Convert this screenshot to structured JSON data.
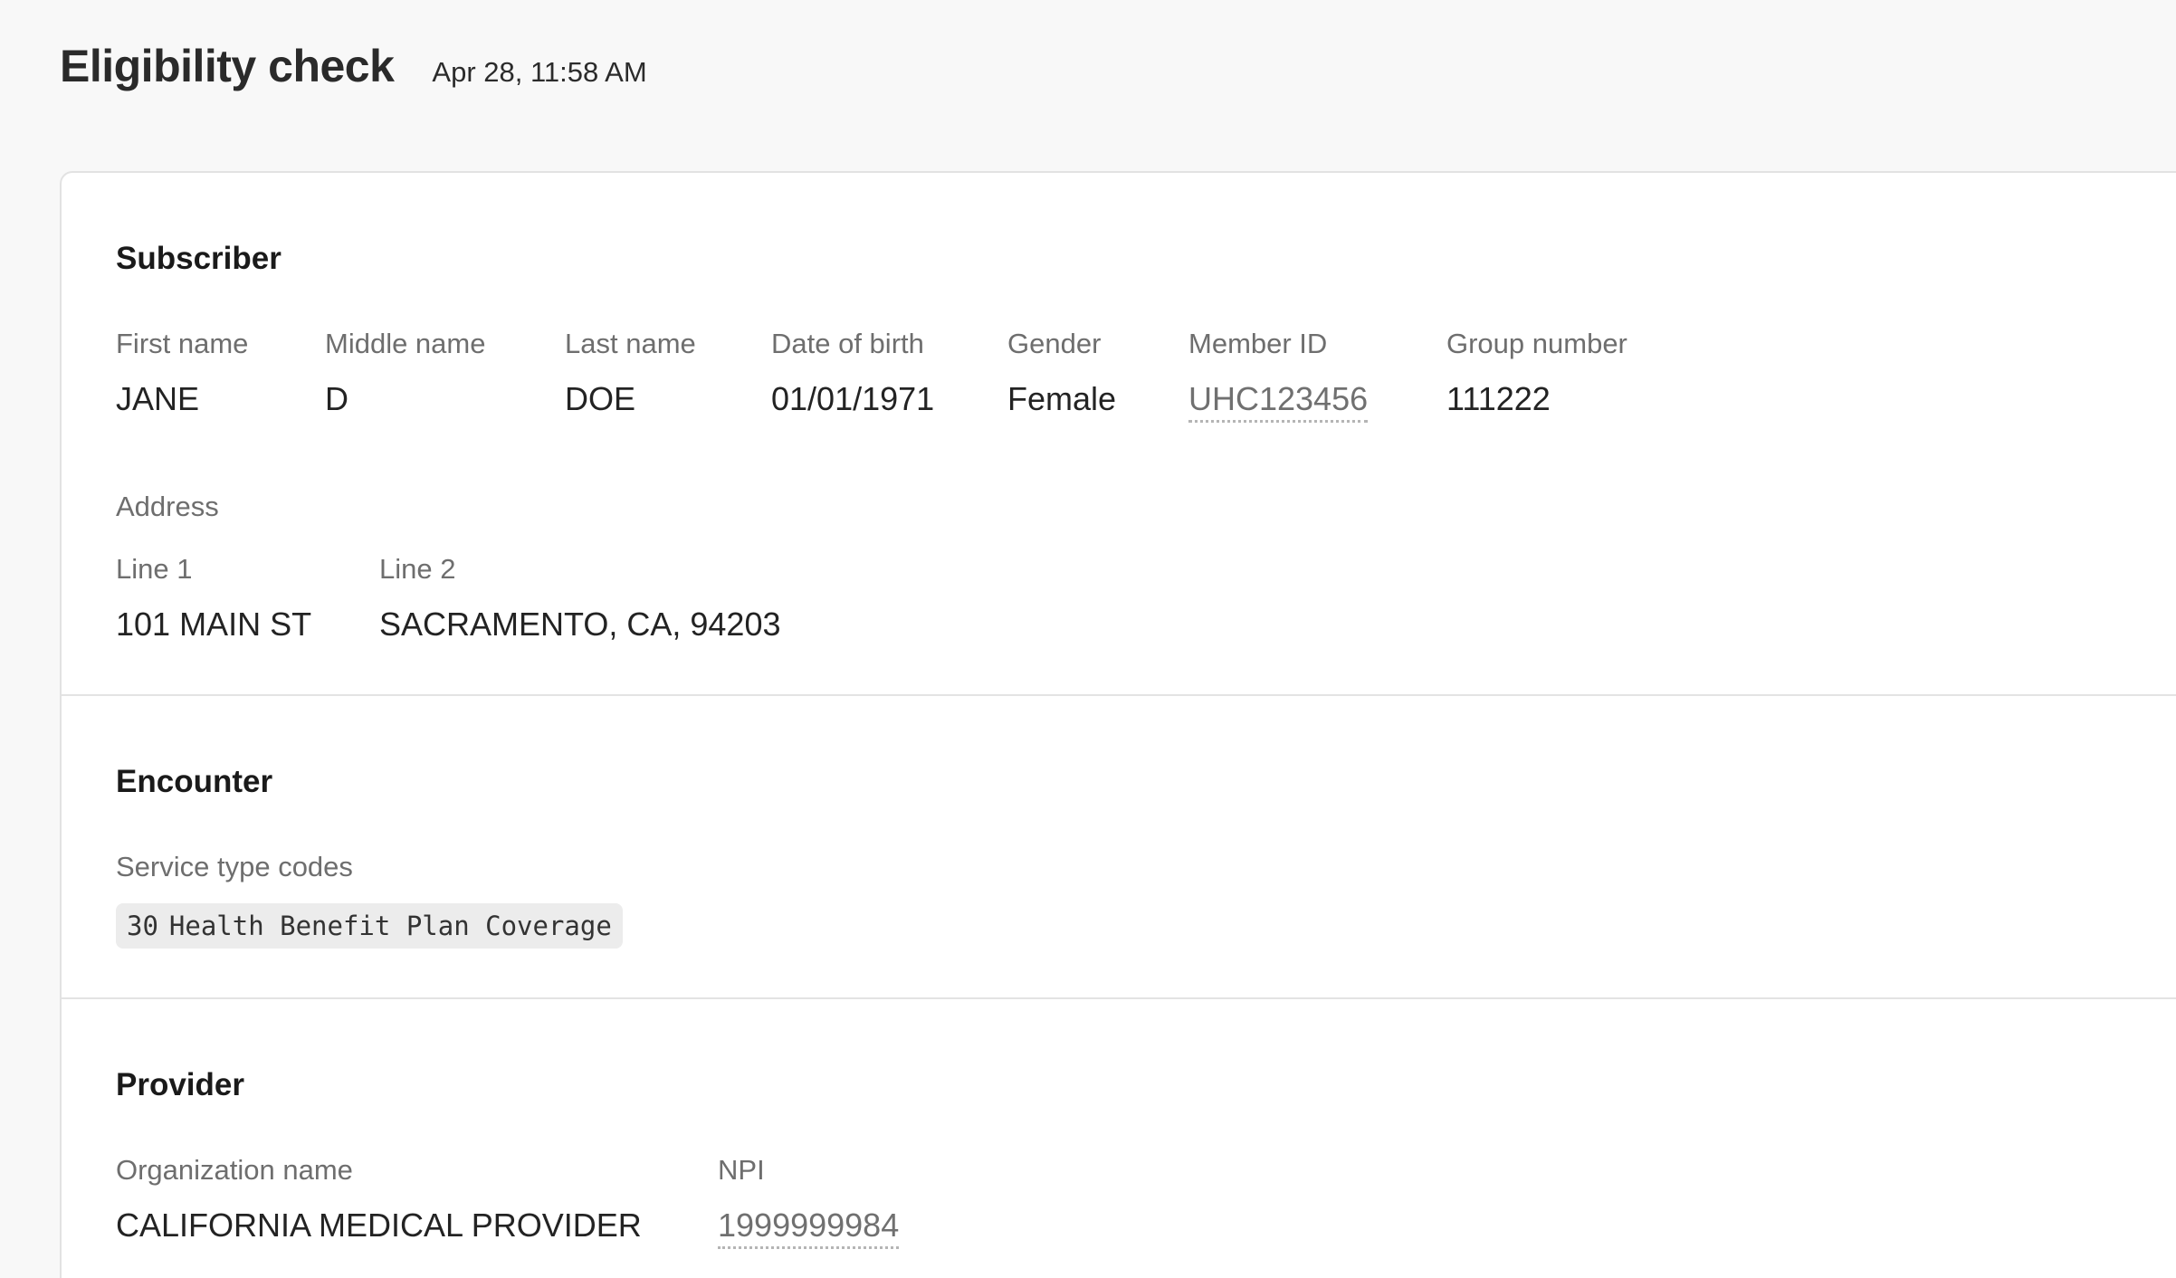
{
  "header": {
    "title": "Eligibility check",
    "timestamp": "Apr 28, 11:58 AM"
  },
  "subscriber": {
    "title": "Subscriber",
    "fields": {
      "first_name": {
        "label": "First name",
        "value": "JANE"
      },
      "middle_name": {
        "label": "Middle name",
        "value": "D"
      },
      "last_name": {
        "label": "Last name",
        "value": "DOE"
      },
      "dob": {
        "label": "Date of birth",
        "value": "01/01/1971"
      },
      "gender": {
        "label": "Gender",
        "value": "Female"
      },
      "member_id": {
        "label": "Member ID",
        "value": "UHC123456"
      },
      "group_number": {
        "label": "Group number",
        "value": "111222"
      }
    },
    "address": {
      "label": "Address",
      "line1": {
        "label": "Line 1",
        "value": "101 MAIN ST"
      },
      "line2": {
        "label": "Line 2",
        "value": "SACRAMENTO, CA, 94203"
      }
    }
  },
  "encounter": {
    "title": "Encounter",
    "service_type_codes": {
      "label": "Service type codes",
      "code": "30",
      "description": "Health Benefit Plan Coverage"
    }
  },
  "provider": {
    "title": "Provider",
    "organization_name": {
      "label": "Organization name",
      "value": "CALIFORNIA MEDICAL PROVIDER"
    },
    "npi": {
      "label": "NPI",
      "value": "1999999984"
    }
  }
}
